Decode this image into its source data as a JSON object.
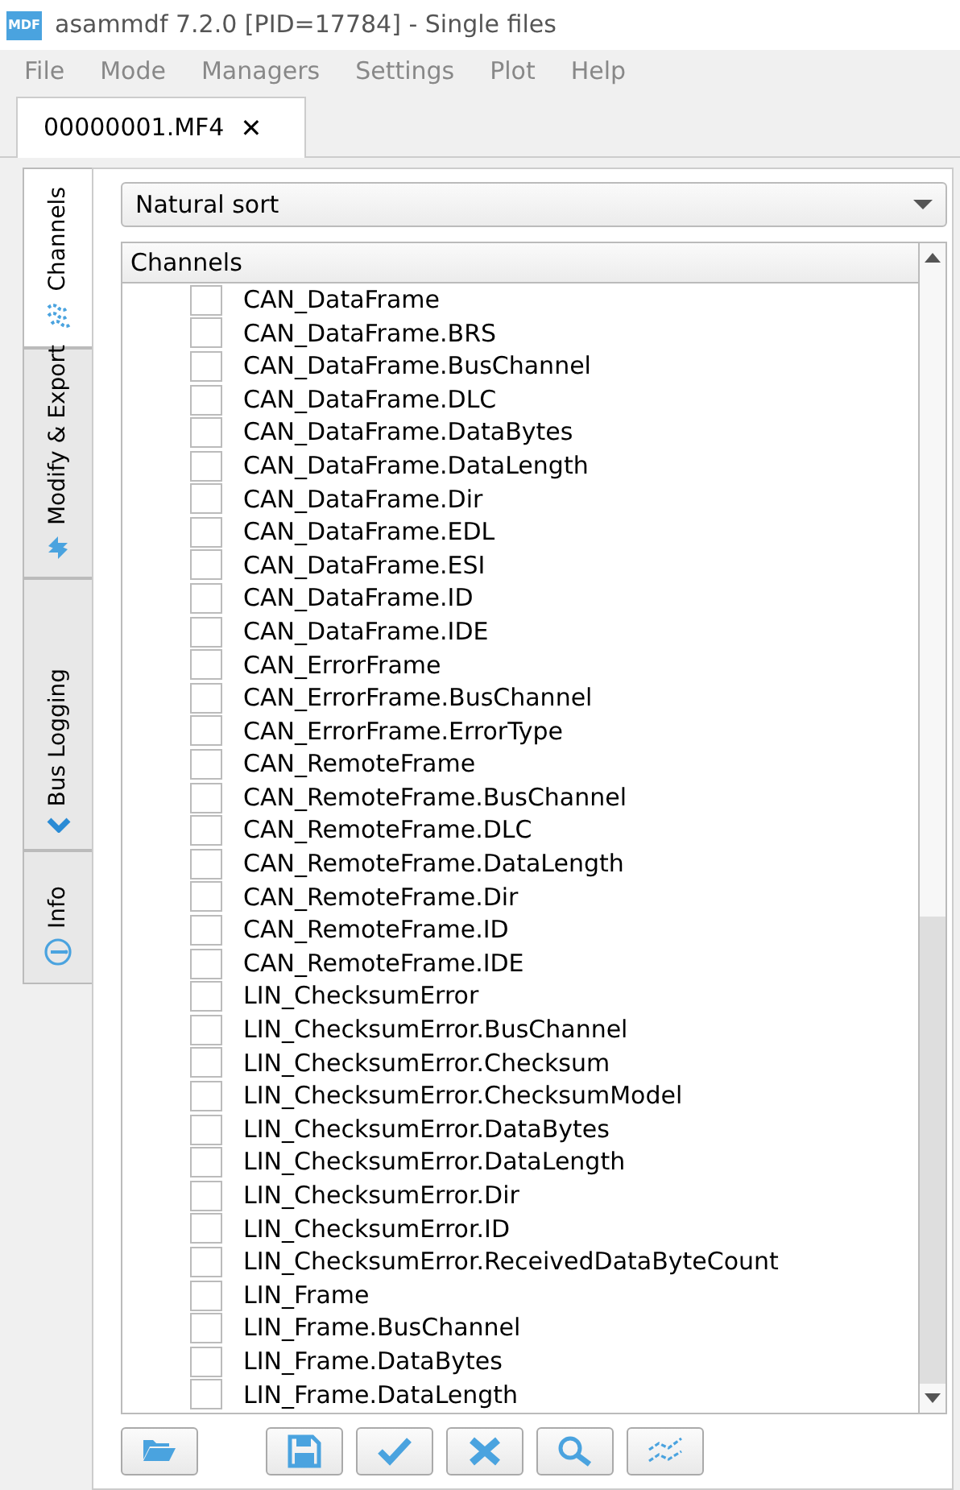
{
  "window": {
    "title": "asammdf 7.2.0 [PID=17784] - Single files",
    "app_icon": "MDF"
  },
  "menu": [
    "File",
    "Mode",
    "Managers",
    "Settings",
    "Plot",
    "Help"
  ],
  "file_tabs": [
    {
      "label": "00000001.MF4",
      "close": "✕",
      "selected": true
    }
  ],
  "side_tabs": [
    {
      "label": "Channels",
      "kind": "channels",
      "selected": true
    },
    {
      "label": "Modify & Export",
      "kind": "modify",
      "selected": false
    },
    {
      "label": "Bus Logging",
      "kind": "bus",
      "selected": false
    },
    {
      "label": "Info",
      "kind": "info",
      "selected": false
    }
  ],
  "sort": {
    "value": "Natural sort"
  },
  "tree": {
    "header": "Channels",
    "items": [
      {
        "label": "CAN_DataFrame",
        "checked": false
      },
      {
        "label": "CAN_DataFrame.BRS",
        "checked": false
      },
      {
        "label": "CAN_DataFrame.BusChannel",
        "checked": false
      },
      {
        "label": "CAN_DataFrame.DLC",
        "checked": false
      },
      {
        "label": "CAN_DataFrame.DataBytes",
        "checked": false
      },
      {
        "label": "CAN_DataFrame.DataLength",
        "checked": false
      },
      {
        "label": "CAN_DataFrame.Dir",
        "checked": false
      },
      {
        "label": "CAN_DataFrame.EDL",
        "checked": false
      },
      {
        "label": "CAN_DataFrame.ESI",
        "checked": false
      },
      {
        "label": "CAN_DataFrame.ID",
        "checked": false
      },
      {
        "label": "CAN_DataFrame.IDE",
        "checked": false
      },
      {
        "label": "CAN_ErrorFrame",
        "checked": false
      },
      {
        "label": "CAN_ErrorFrame.BusChannel",
        "checked": false
      },
      {
        "label": "CAN_ErrorFrame.ErrorType",
        "checked": false
      },
      {
        "label": "CAN_RemoteFrame",
        "checked": false
      },
      {
        "label": "CAN_RemoteFrame.BusChannel",
        "checked": false
      },
      {
        "label": "CAN_RemoteFrame.DLC",
        "checked": false
      },
      {
        "label": "CAN_RemoteFrame.DataLength",
        "checked": false
      },
      {
        "label": "CAN_RemoteFrame.Dir",
        "checked": false
      },
      {
        "label": "CAN_RemoteFrame.ID",
        "checked": false
      },
      {
        "label": "CAN_RemoteFrame.IDE",
        "checked": false
      },
      {
        "label": "LIN_ChecksumError",
        "checked": false
      },
      {
        "label": "LIN_ChecksumError.BusChannel",
        "checked": false
      },
      {
        "label": "LIN_ChecksumError.Checksum",
        "checked": false
      },
      {
        "label": "LIN_ChecksumError.ChecksumModel",
        "checked": false
      },
      {
        "label": "LIN_ChecksumError.DataBytes",
        "checked": false
      },
      {
        "label": "LIN_ChecksumError.DataLength",
        "checked": false
      },
      {
        "label": "LIN_ChecksumError.Dir",
        "checked": false
      },
      {
        "label": "LIN_ChecksumError.ID",
        "checked": false
      },
      {
        "label": "LIN_ChecksumError.ReceivedDataByteCount",
        "checked": false
      },
      {
        "label": "LIN_Frame",
        "checked": false
      },
      {
        "label": "LIN_Frame.BusChannel",
        "checked": false
      },
      {
        "label": "LIN_Frame.DataBytes",
        "checked": false
      },
      {
        "label": "LIN_Frame.DataLength",
        "checked": false
      }
    ]
  },
  "toolbar": [
    {
      "kind": "open"
    },
    {
      "kind": "save"
    },
    {
      "kind": "check"
    },
    {
      "kind": "clear"
    },
    {
      "kind": "search"
    },
    {
      "kind": "plot"
    }
  ]
}
